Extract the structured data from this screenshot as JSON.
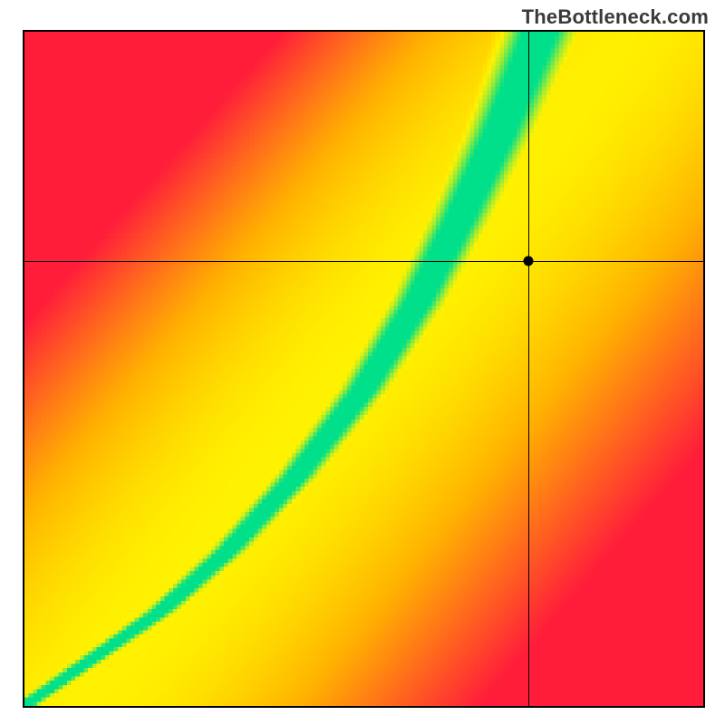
{
  "watermark": "TheBottleneck.com",
  "chart_data": {
    "type": "heatmap",
    "title": "",
    "xlabel": "",
    "ylabel": "",
    "xlim": [
      0,
      1
    ],
    "ylim": [
      0,
      1
    ],
    "color_scale": [
      "#ff1d3a",
      "#ffb300",
      "#fff200",
      "#00e08a"
    ],
    "color_meaning": "green = optimal match along ridge, red = worst mismatch",
    "ridge_points": [
      {
        "x": 0.0,
        "y": 0.0
      },
      {
        "x": 0.1,
        "y": 0.07
      },
      {
        "x": 0.2,
        "y": 0.14
      },
      {
        "x": 0.3,
        "y": 0.23
      },
      {
        "x": 0.4,
        "y": 0.34
      },
      {
        "x": 0.5,
        "y": 0.47
      },
      {
        "x": 0.58,
        "y": 0.6
      },
      {
        "x": 0.64,
        "y": 0.72
      },
      {
        "x": 0.7,
        "y": 0.85
      },
      {
        "x": 0.76,
        "y": 1.0
      }
    ],
    "secondary_ridge_points": [
      {
        "x": 0.55,
        "y": 0.5
      },
      {
        "x": 0.7,
        "y": 0.62
      },
      {
        "x": 0.85,
        "y": 0.78
      },
      {
        "x": 1.0,
        "y": 0.95
      }
    ],
    "crosshair": {
      "x": 0.742,
      "y": 0.66
    },
    "marker": {
      "x": 0.742,
      "y": 0.66
    },
    "grid": false,
    "legend": false
  }
}
